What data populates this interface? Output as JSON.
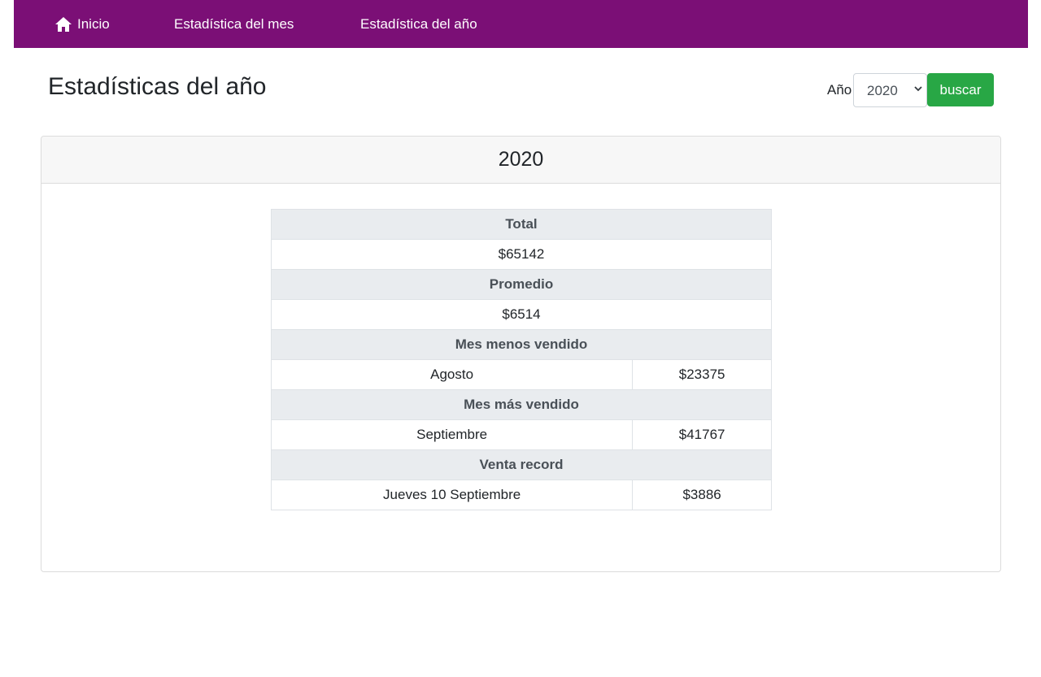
{
  "nav": {
    "home_label": "Inicio",
    "month_stats_label": "Estadística del mes",
    "year_stats_label": "Estadística del año"
  },
  "page": {
    "title": "Estadísticas del año"
  },
  "filter": {
    "label": "Año",
    "selected_year": "2020",
    "search_label": "buscar"
  },
  "card": {
    "header": "2020"
  },
  "stats": {
    "total_header": "Total",
    "total_value": "$65142",
    "average_header": "Promedio",
    "average_value": "$6514",
    "least_sold_header": "Mes menos vendido",
    "least_sold_month": "Agosto",
    "least_sold_value": "$23375",
    "most_sold_header": "Mes más vendido",
    "most_sold_month": "Septiembre",
    "most_sold_value": "$41767",
    "record_header": "Venta record",
    "record_day": "Jueves 10 Septiembre",
    "record_value": "$3886"
  },
  "colors": {
    "navbar": "#7b0f76",
    "button": "#28a745"
  }
}
